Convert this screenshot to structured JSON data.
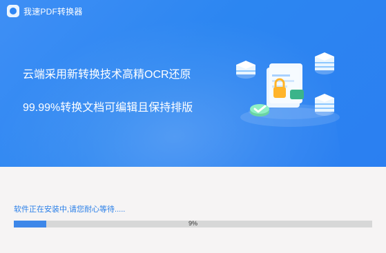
{
  "app": {
    "title": "我速PDF转换器",
    "logo_icon": "app-logo-icon"
  },
  "banner": {
    "line1": "云端采用新转换技术高精OCR还原",
    "line2": "99.99%转换文档可编辑且保持排版",
    "illustration_icon": "document-cloud-illustration"
  },
  "install": {
    "status_text": "软件正在安装中,请您耐心等待.....",
    "progress_value": 9,
    "progress_label": "9%"
  },
  "colors": {
    "banner": "#2c86f1",
    "progress_fill": "#3d87e9",
    "status_text": "#2a7fe8"
  }
}
